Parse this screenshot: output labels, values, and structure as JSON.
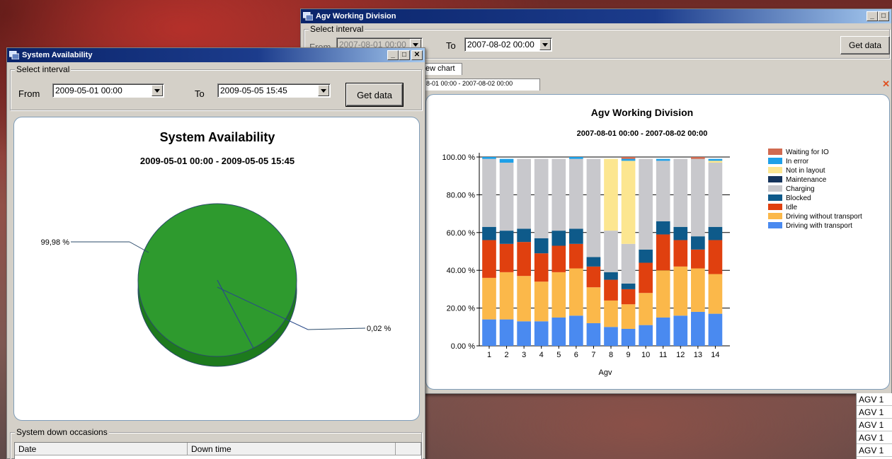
{
  "agv_window": {
    "title": "Agv Working Division",
    "interval_legend": "Select interval",
    "from_label": "From",
    "from_value": "2007-08-01 00:00",
    "to_label": "To",
    "to_value": "2007-08-02 00:00",
    "get_data_label": "Get data",
    "tab_new_chart": "ew chart",
    "tab_range": "8-01 00:00 - 2007-08-02 00:00",
    "list_items": [
      "AGV 1",
      "AGV 1",
      "AGV 1",
      "AGV 1",
      "AGV 1"
    ]
  },
  "sys_window": {
    "title": "System Availability",
    "interval_legend": "Select interval",
    "from_label": "From",
    "from_value": "2009-05-01 00:00",
    "to_label": "To",
    "to_value": "2009-05-05 15:45",
    "get_data_label": "Get data",
    "down_legend": "System down occasions",
    "table_headers": [
      "Date",
      "Down time",
      ""
    ]
  },
  "chart_data": [
    {
      "type": "pie",
      "title": "System Availability",
      "subtitle": "2009-05-01 00:00 - 2009-05-05 15:45",
      "slices": [
        {
          "label": "99,98 %",
          "value": 99.98,
          "color": "#2e9a2e"
        },
        {
          "label": "0,02 %",
          "value": 0.02,
          "color": "#1f5fbf"
        }
      ]
    },
    {
      "type": "bar",
      "stacked": true,
      "title": "Agv Working Division",
      "subtitle": "2007-08-01 00:00 - 2007-08-02 00:00",
      "xlabel": "Agv",
      "ylabel": "",
      "ylim": [
        0,
        100
      ],
      "yticks": [
        "0.00 %",
        "20.00 %",
        "40.00 %",
        "60.00 %",
        "80.00 %",
        "100.00 %"
      ],
      "categories": [
        "1",
        "2",
        "3",
        "4",
        "5",
        "6",
        "7",
        "8",
        "9",
        "10",
        "11",
        "12",
        "13",
        "14"
      ],
      "legend_position": "right",
      "series": [
        {
          "name": "Driving with transport",
          "color": "#4a8af0",
          "values": [
            14,
            14,
            13,
            13,
            15,
            16,
            12,
            10,
            9,
            11,
            15,
            16,
            18,
            17
          ]
        },
        {
          "name": "Driving without transport",
          "color": "#fbb84a",
          "values": [
            22,
            25,
            24,
            21,
            24,
            25,
            19,
            14,
            13,
            17,
            25,
            26,
            23,
            21
          ]
        },
        {
          "name": "Idle",
          "color": "#e0400f",
          "values": [
            20,
            15,
            18,
            15,
            14,
            13,
            11,
            11,
            8,
            16,
            19,
            14,
            10,
            18
          ]
        },
        {
          "name": "Blocked",
          "color": "#0e5a8a",
          "values": [
            7,
            7,
            7,
            8,
            8,
            8,
            5,
            4,
            3,
            7,
            7,
            7,
            7,
            7
          ]
        },
        {
          "name": "Charging",
          "color": "#c8c8cc",
          "values": [
            36,
            36,
            37,
            42,
            38,
            37,
            52,
            22,
            21,
            48,
            32,
            36,
            41,
            34
          ]
        },
        {
          "name": "Maintenance",
          "color": "#15345c",
          "values": [
            0,
            0,
            0,
            0,
            0,
            0,
            0,
            0,
            0,
            0,
            0,
            0,
            0,
            0
          ]
        },
        {
          "name": "Not in layout",
          "color": "#fce690",
          "values": [
            0,
            0,
            0,
            0,
            0,
            0,
            0,
            38,
            44,
            0,
            0,
            0,
            0,
            1
          ]
        },
        {
          "name": "In error",
          "color": "#1ea0e8",
          "values": [
            1,
            2,
            0,
            0,
            0,
            1,
            0,
            0,
            1,
            0,
            1,
            0,
            0,
            1
          ]
        },
        {
          "name": "Waiting for IO",
          "color": "#d06a50",
          "values": [
            0,
            0,
            0,
            0,
            0,
            0,
            0,
            0,
            1,
            0,
            0,
            0,
            1,
            0
          ]
        }
      ]
    }
  ]
}
